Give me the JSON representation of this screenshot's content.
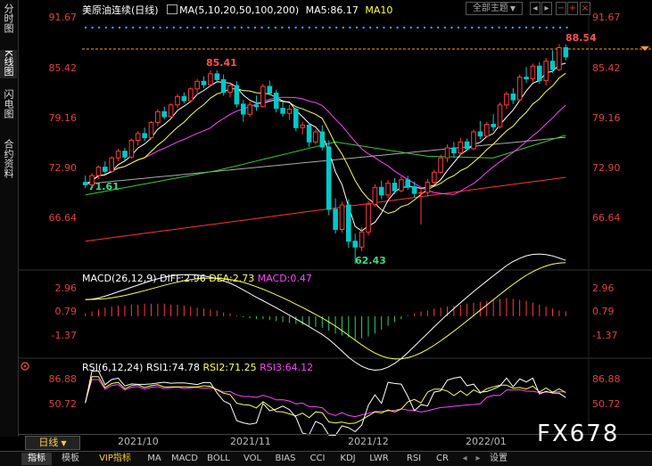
{
  "sidebar": {
    "tabs": [
      {
        "label": "分时图",
        "active": false
      },
      {
        "label": "K线图",
        "active": true
      },
      {
        "label": "闪电图",
        "active": false
      },
      {
        "label": "合约资料",
        "active": false
      }
    ]
  },
  "header": {
    "instrument": "美原油连续",
    "period": "日线",
    "ma_label": "MA(5,10,20,50,100,200)",
    "ma5_label": "MA5:86.17",
    "ma10_label": "MA10",
    "theme_button": "全部主题",
    "theme_caret": "▼"
  },
  "macd": {
    "label": "MACD(26,12,9)",
    "diff": "DIFF:2.96",
    "dea": "DEA:2.73",
    "macd": "MACD:0.47"
  },
  "rsi": {
    "label": "RSI(6,12,24)",
    "rsi1": "RSI1:74.78",
    "rsi2": "RSI2:71.25",
    "rsi3": "RSI3:64.12"
  },
  "bottom": {
    "period_tab": "日线",
    "tabs": [
      "指标",
      "模板",
      "VIP指标",
      "MA",
      "MACD",
      "BOLL",
      "VOL",
      "BIAS",
      "CCI",
      "KDJ",
      "LWR",
      "RSI",
      "CR",
      "设置"
    ],
    "active_tab": "指标"
  },
  "watermark": "FX678",
  "colors": {
    "up": "#ff3b3b",
    "down": "#00c8c8",
    "ma5": "#ffffff",
    "ma10": "#ffff55",
    "ma20": "#ff44ff",
    "ma50": "#33cc33",
    "ma100": "#aaaaaa",
    "ma200": "#ff3333",
    "macd_pos": "#ff3b3b",
    "macd_neg": "#33cc66"
  },
  "chart_data": {
    "type": "candlestick",
    "x_labels": [
      "2021/10",
      "2021/11",
      "2021/12",
      "2022/01"
    ],
    "price": {
      "y_ticks": [
        "91.67",
        "85.42",
        "79.16",
        "72.90",
        "66.64"
      ],
      "ylim": [
        62.0,
        92.5
      ],
      "high_label": "85.41",
      "low_label": "62.43",
      "start_label": "71.61",
      "last_label": "88.54",
      "ohlc": [
        [
          72.1,
          72.9,
          71.4,
          71.8
        ],
        [
          71.8,
          73.2,
          71.6,
          72.9
        ],
        [
          72.9,
          74.1,
          72.5,
          73.9
        ],
        [
          73.9,
          74.6,
          73.1,
          73.4
        ],
        [
          73.4,
          75.2,
          73.2,
          75.0
        ],
        [
          75.0,
          76.1,
          74.6,
          75.8
        ],
        [
          75.8,
          76.2,
          74.7,
          75.1
        ],
        [
          75.1,
          77.3,
          74.9,
          77.1
        ],
        [
          77.1,
          78.2,
          76.5,
          77.9
        ],
        [
          77.9,
          78.6,
          77.0,
          77.4
        ],
        [
          77.4,
          79.4,
          77.2,
          79.2
        ],
        [
          79.2,
          80.8,
          78.8,
          80.5
        ],
        [
          80.5,
          81.1,
          79.6,
          79.9
        ],
        [
          79.9,
          81.5,
          79.7,
          81.3
        ],
        [
          81.3,
          82.6,
          80.9,
          82.3
        ],
        [
          82.3,
          82.8,
          81.5,
          81.8
        ],
        [
          81.8,
          83.4,
          81.6,
          83.2
        ],
        [
          83.2,
          84.4,
          82.5,
          84.1
        ],
        [
          84.1,
          84.7,
          83.3,
          83.7
        ],
        [
          83.7,
          85.4,
          83.5,
          85.0
        ],
        [
          85.0,
          85.41,
          83.9,
          84.3
        ],
        [
          84.3,
          84.9,
          82.4,
          82.8
        ],
        [
          82.8,
          84.0,
          82.2,
          83.6
        ],
        [
          83.6,
          84.1,
          81.0,
          81.4
        ],
        [
          81.4,
          81.9,
          79.3,
          80.2
        ],
        [
          80.2,
          81.7,
          79.9,
          81.3
        ],
        [
          81.3,
          82.4,
          80.6,
          81.1
        ],
        [
          81.1,
          83.8,
          81.0,
          83.5
        ],
        [
          83.5,
          84.2,
          82.4,
          82.7
        ],
        [
          82.7,
          83.1,
          80.4,
          80.9
        ],
        [
          80.9,
          81.6,
          79.9,
          80.3
        ],
        [
          80.3,
          81.3,
          79.5,
          80.8
        ],
        [
          80.8,
          81.2,
          78.2,
          78.6
        ],
        [
          78.6,
          79.3,
          77.8,
          78.9
        ],
        [
          78.9,
          79.1,
          76.3,
          76.9
        ],
        [
          76.9,
          78.4,
          76.6,
          78.1
        ],
        [
          78.1,
          78.9,
          75.9,
          76.3
        ],
        [
          76.3,
          77.1,
          68.2,
          68.9
        ],
        [
          68.9,
          70.2,
          66.0,
          66.5
        ],
        [
          66.5,
          69.8,
          66.1,
          69.4
        ],
        [
          69.4,
          70.1,
          64.3,
          65.1
        ],
        [
          65.1,
          66.0,
          62.43,
          64.4
        ],
        [
          64.4,
          66.8,
          63.9,
          66.2
        ],
        [
          66.2,
          69.9,
          65.8,
          69.5
        ],
        [
          69.5,
          71.9,
          69.2,
          71.5
        ],
        [
          71.5,
          72.3,
          70.1,
          70.6
        ],
        [
          70.6,
          72.4,
          70.2,
          72.0
        ],
        [
          72.0,
          72.6,
          70.7,
          71.1
        ],
        [
          71.1,
          72.8,
          70.9,
          72.4
        ],
        [
          72.4,
          72.9,
          71.2,
          71.6
        ],
        [
          71.6,
          72.2,
          70.3,
          70.8
        ],
        [
          70.8,
          71.6,
          67.1,
          70.9
        ],
        [
          70.9,
          72.5,
          70.4,
          72.1
        ],
        [
          72.1,
          73.6,
          71.8,
          73.3
        ],
        [
          73.3,
          75.4,
          73.1,
          75.0
        ],
        [
          75.0,
          76.6,
          74.5,
          76.2
        ],
        [
          76.2,
          76.9,
          75.0,
          75.6
        ],
        [
          75.6,
          77.4,
          75.3,
          76.9
        ],
        [
          76.9,
          77.3,
          75.8,
          76.1
        ],
        [
          76.1,
          78.4,
          75.9,
          78.1
        ],
        [
          78.1,
          79.4,
          77.2,
          77.6
        ],
        [
          77.6,
          79.3,
          77.4,
          79.0
        ],
        [
          79.0,
          80.2,
          78.2,
          78.7
        ],
        [
          78.7,
          81.6,
          78.5,
          81.3
        ],
        [
          81.3,
          82.9,
          80.8,
          82.6
        ],
        [
          82.6,
          83.3,
          81.4,
          81.9
        ],
        [
          81.9,
          84.9,
          81.7,
          84.6
        ],
        [
          84.6,
          85.8,
          83.9,
          84.4
        ],
        [
          84.4,
          86.2,
          84.0,
          85.9
        ],
        [
          85.9,
          86.4,
          83.8,
          84.2
        ],
        [
          84.2,
          86.9,
          83.6,
          86.5
        ],
        [
          86.5,
          87.8,
          85.1,
          85.5
        ],
        [
          85.5,
          88.54,
          85.3,
          88.1
        ],
        [
          88.1,
          88.5,
          86.6,
          87.0
        ]
      ],
      "ma100": [
        [
          0,
          71.9
        ],
        [
          75,
          77.6
        ]
      ],
      "ma200": [
        [
          0,
          65.1
        ],
        [
          75,
          72.9
        ]
      ],
      "ma50": [
        [
          0,
          70.6
        ],
        [
          20,
          73.5
        ],
        [
          38,
          76.9
        ],
        [
          52,
          75.2
        ],
        [
          62,
          75.0
        ],
        [
          75,
          78.2
        ]
      ]
    },
    "macd_panel": {
      "y_ticks": [
        "2.96",
        "0.79",
        "-1.37"
      ],
      "ylim": [
        -3.8,
        3.6
      ],
      "hist": [
        0.3,
        0.5,
        0.7,
        0.9,
        1.0,
        1.1,
        1.1,
        1.2,
        1.2,
        1.3,
        1.3,
        1.3,
        1.3,
        1.2,
        1.2,
        1.1,
        1.0,
        0.9,
        0.8,
        0.7,
        0.6,
        0.4,
        0.3,
        0.1,
        -0.1,
        -0.2,
        -0.3,
        -0.3,
        -0.4,
        -0.5,
        -0.6,
        -0.7,
        -0.8,
        -0.9,
        -1.0,
        -1.1,
        -1.2,
        -1.5,
        -1.8,
        -2.0,
        -2.2,
        -2.4,
        -2.3,
        -2.1,
        -1.8,
        -1.4,
        -1.0,
        -0.6,
        -0.3,
        0.1,
        0.3,
        0.5,
        0.6,
        0.8,
        0.9,
        1.0,
        1.1,
        1.2,
        1.3,
        1.4,
        1.5,
        1.6,
        1.7,
        1.8,
        1.9,
        1.8,
        1.7,
        1.6,
        1.4,
        1.2,
        1.0,
        0.8,
        0.6,
        0.5
      ]
    },
    "rsi_panel": {
      "y_ticks": [
        "86.88",
        "50.72"
      ],
      "ylim": [
        28,
        98
      ]
    }
  }
}
